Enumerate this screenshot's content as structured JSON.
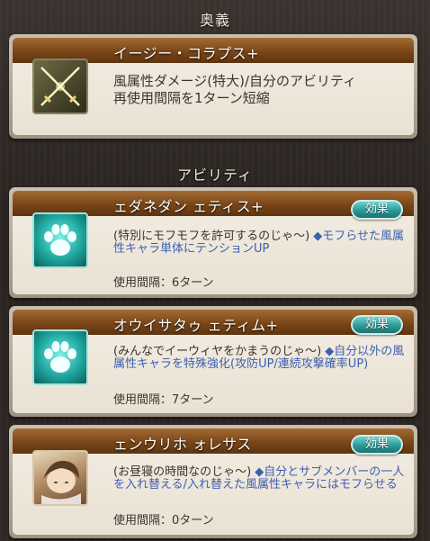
{
  "ougi": {
    "section_title": "奥義",
    "name": "イージー・コラプス+",
    "description_line1": "風属性ダメージ(特大)/自分のアビリティ",
    "description_line2": "再使用間隔を1ターン短縮",
    "icon": "crossed-swords-icon"
  },
  "abilities_section_title": "アビリティ",
  "abilities": [
    {
      "name": "ェダネダン ェティス+",
      "flavor": "(特別にモフモフを許可するのじゃ～)",
      "effect": "◆モフらせた風属性キャラ単体にテンションUP",
      "cooldown": "使用間隔：6ターン",
      "button": "効果",
      "icon": "paw-icon"
    },
    {
      "name": "オウイサタゥ ェティム+",
      "flavor": "(みんなでイーウィヤをかまうのじゃ～)",
      "effect": "◆自分以外の風属性キャラを特殊強化(攻防UP/連続攻撃確率UP)",
      "cooldown": "使用間隔：7ターン",
      "button": "効果",
      "icon": "paw-icon"
    },
    {
      "name": "ェンウリホ ォレサス",
      "flavor": "(お昼寝の時間なのじゃ～)",
      "effect": "◆自分とサブメンバーの一人を入れ替える/入れ替えた風属性キャラにはモフらせる",
      "cooldown": "使用間隔：0ターン",
      "button": "効果",
      "icon": "character-portrait-icon"
    }
  ],
  "colors": {
    "title_bar": "#7a4618",
    "effect_text": "#3d5fb0",
    "button": "#2b9a96"
  }
}
